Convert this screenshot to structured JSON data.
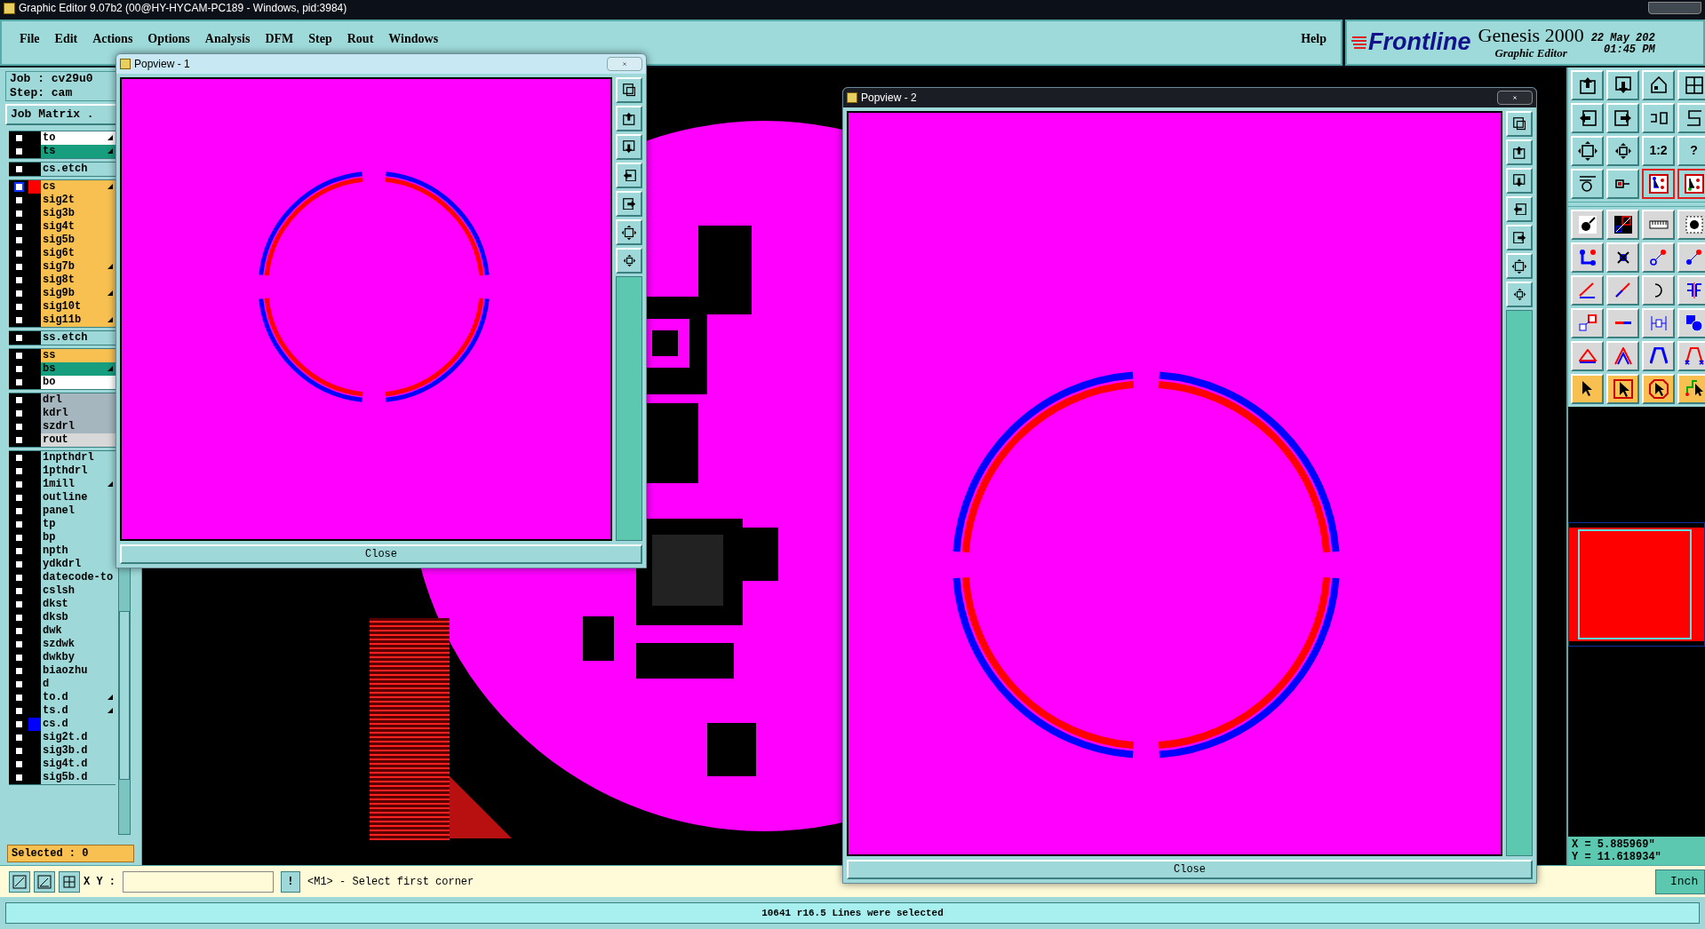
{
  "window": {
    "title": "Graphic Editor 9.07b2 (00@HY-HYCAM-PC189 - Windows, pid:3984)"
  },
  "menu": [
    "File",
    "Edit",
    "Actions",
    "Options",
    "Analysis",
    "DFM",
    "Step",
    "Rout",
    "Windows"
  ],
  "help": "Help",
  "brand": {
    "logo": "Frontline",
    "product": "Genesis 2000",
    "subtitle": "Graphic Editor",
    "date": "22 May 202",
    "time": "01:45 PM"
  },
  "job": {
    "job": "Job : cv29u0",
    "step": "Step: cam",
    "matrix_button": "Job Matrix ."
  },
  "layer_groups": [
    [
      {
        "name": "to",
        "kind": "silk_screen",
        "edited": true,
        "selected": false
      },
      {
        "name": "ts",
        "kind": "solder_mask",
        "edited": true,
        "selected": false
      }
    ],
    [
      {
        "name": "cs.etch",
        "kind": "document",
        "edited": false,
        "selected": false
      }
    ],
    [
      {
        "name": "cs",
        "kind": "signal",
        "edited": true,
        "selected": true,
        "color": "#ff0000"
      },
      {
        "name": "sig2t",
        "kind": "signal",
        "edited": false,
        "selected": false
      },
      {
        "name": "sig3b",
        "kind": "signal",
        "edited": false,
        "selected": false
      },
      {
        "name": "sig4t",
        "kind": "signal",
        "edited": false,
        "selected": false
      },
      {
        "name": "sig5b",
        "kind": "signal",
        "edited": false,
        "selected": false
      },
      {
        "name": "sig6t",
        "kind": "signal",
        "edited": false,
        "selected": false
      },
      {
        "name": "sig7b",
        "kind": "signal",
        "edited": true,
        "selected": false
      },
      {
        "name": "sig8t",
        "kind": "signal",
        "edited": false,
        "selected": false
      },
      {
        "name": "sig9b",
        "kind": "signal",
        "edited": true,
        "selected": false
      },
      {
        "name": "sig10t",
        "kind": "signal",
        "edited": false,
        "selected": false
      },
      {
        "name": "sig11b",
        "kind": "signal",
        "edited": true,
        "selected": false
      }
    ],
    [
      {
        "name": "ss.etch",
        "kind": "document",
        "edited": false,
        "selected": false
      }
    ],
    [
      {
        "name": "ss",
        "kind": "solder_paste",
        "edited": false,
        "selected": false
      },
      {
        "name": "bs",
        "kind": "solder_mask",
        "edited": true,
        "selected": false
      },
      {
        "name": "bo",
        "kind": "silk_screen",
        "edited": false,
        "selected": false
      }
    ],
    [
      {
        "name": "drl",
        "kind": "drill",
        "edited": false,
        "selected": false
      },
      {
        "name": "kdrl",
        "kind": "drill",
        "edited": false,
        "selected": false
      },
      {
        "name": "szdrl",
        "kind": "drill",
        "edited": false,
        "selected": false
      },
      {
        "name": "rout",
        "kind": "rout",
        "edited": false,
        "selected": false
      }
    ],
    [
      {
        "name": "1npthdrl",
        "kind": "document",
        "edited": false,
        "selected": false
      },
      {
        "name": "1pthdrl",
        "kind": "document",
        "edited": false,
        "selected": false
      },
      {
        "name": "1mill",
        "kind": "document",
        "edited": true,
        "selected": false
      },
      {
        "name": "outline",
        "kind": "document",
        "edited": false,
        "selected": false
      },
      {
        "name": "panel",
        "kind": "document",
        "edited": false,
        "selected": false
      },
      {
        "name": "tp",
        "kind": "document",
        "edited": false,
        "selected": false
      },
      {
        "name": "bp",
        "kind": "document",
        "edited": false,
        "selected": false
      },
      {
        "name": "npth",
        "kind": "document",
        "edited": false,
        "selected": false
      },
      {
        "name": "ydkdrl",
        "kind": "document",
        "edited": false,
        "selected": false
      },
      {
        "name": "datecode-to",
        "kind": "document",
        "edited": false,
        "selected": false
      },
      {
        "name": "cslsh",
        "kind": "document",
        "edited": false,
        "selected": false
      },
      {
        "name": "dkst",
        "kind": "document",
        "edited": false,
        "selected": false
      },
      {
        "name": "dksb",
        "kind": "document",
        "edited": false,
        "selected": false
      },
      {
        "name": "dwk",
        "kind": "document",
        "edited": false,
        "selected": false
      },
      {
        "name": "szdwk",
        "kind": "document",
        "edited": false,
        "selected": false
      },
      {
        "name": "dwkby",
        "kind": "document",
        "edited": false,
        "selected": false
      },
      {
        "name": "biaozhu",
        "kind": "document",
        "edited": false,
        "selected": false
      },
      {
        "name": "d",
        "kind": "document",
        "edited": false,
        "selected": false
      },
      {
        "name": "to.d",
        "kind": "document",
        "edited": true,
        "selected": false
      },
      {
        "name": "ts.d",
        "kind": "document",
        "edited": true,
        "selected": false
      },
      {
        "name": "cs.d",
        "kind": "document",
        "edited": false,
        "selected": false,
        "color": "#0000ff"
      },
      {
        "name": "sig2t.d",
        "kind": "document",
        "edited": false,
        "selected": false
      },
      {
        "name": "sig3b.d",
        "kind": "document",
        "edited": false,
        "selected": false
      },
      {
        "name": "sig4t.d",
        "kind": "document",
        "edited": false,
        "selected": false
      },
      {
        "name": "sig5b.d",
        "kind": "document",
        "edited": false,
        "selected": false
      }
    ]
  ],
  "selected_count": "Selected : 0",
  "popviews": [
    {
      "title": "Popview - 1",
      "close": "Close",
      "active": false
    },
    {
      "title": "Popview - 2",
      "close": "Close",
      "active": true
    }
  ],
  "toolbar_labels": [
    "1:2",
    "?"
  ],
  "coordinates": {
    "x": "X = 5.885969\"",
    "y": "Y = 11.618934\""
  },
  "command": {
    "xy_label": "X Y :",
    "exclaim": "!",
    "prompt": "<M1> - Select first corner",
    "units": "Inch"
  },
  "status": "10641 r16.5 Lines were selected"
}
